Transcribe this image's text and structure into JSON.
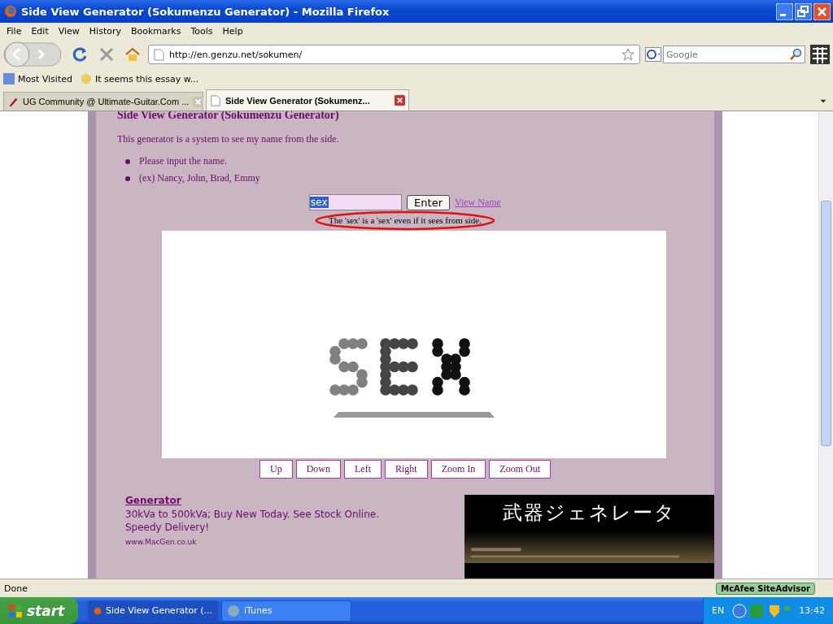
{
  "window": {
    "title": "Side View Generator (Sokumenzu Generator) - Mozilla Firefox"
  },
  "menu": [
    "File",
    "Edit",
    "View",
    "History",
    "Bookmarks",
    "Tools",
    "Help"
  ],
  "toolbar": {
    "url": "http://en.genzu.net/sokumen/",
    "search_placeholder": "Google"
  },
  "bookmarks": [
    "Most Visited",
    "It seems this essay w..."
  ],
  "tabs": [
    {
      "label": "UG Community @ Ultimate-Guitar.Com ...",
      "selected": false
    },
    {
      "label": "Side View Generator (Sokumenz...",
      "selected": true
    }
  ],
  "page": {
    "heading": "Side View Generator (Sokumenzu Generator)",
    "intro": "This generator is a system to see my name from the side.",
    "bullets": [
      "Please input the name.",
      "(ex) Nancy, John, Brad, Emmy"
    ],
    "name_value": "sex",
    "enter_button": "Enter",
    "view_link": "View Name",
    "result": "The 'sex' is a 'sex' even if it sees from side.",
    "nav_buttons": [
      "Up",
      "Down",
      "Left",
      "Right",
      "Zoom In",
      "Zoom Out"
    ],
    "ad": {
      "title": "Generator",
      "text": "30kVa to 500kVa; Buy New Today. See Stock Online. Speedy Delivery!",
      "url": "www.MacGen.co.uk"
    },
    "banner": {
      "title": "武器ジェネレータ"
    }
  },
  "status_bar": {
    "text": "Done",
    "addon": "McAfee SiteAdvisor"
  },
  "taskbar": {
    "start": "start",
    "tasks": [
      {
        "label": "Side View Generator (...",
        "selected": true
      },
      {
        "label": "iTunes",
        "selected": false
      }
    ],
    "language": "EN",
    "clock": "13:42"
  }
}
